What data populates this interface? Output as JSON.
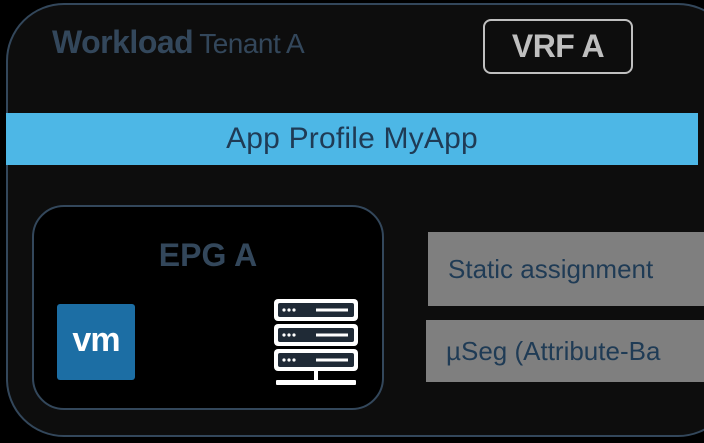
{
  "tenant": {
    "title_bold": "Workload",
    "title_light": "Tenant A"
  },
  "vrf": {
    "label": "VRF A"
  },
  "app_profile": {
    "label": "App Profile MyApp"
  },
  "epg": {
    "label": "EPG A",
    "vm_icon_text": "vm",
    "icons": [
      "vmware-vm-icon",
      "server-rack-icon"
    ]
  },
  "assignments": [
    {
      "label": "Static assignment"
    },
    {
      "label": "µSeg (Attribute-Ba"
    }
  ],
  "colors": {
    "accent_blue": "#4db7e6",
    "dark_slate": "#33475b",
    "vm_blue": "#1c6ea4",
    "grey_box": "#7f7f7f"
  }
}
